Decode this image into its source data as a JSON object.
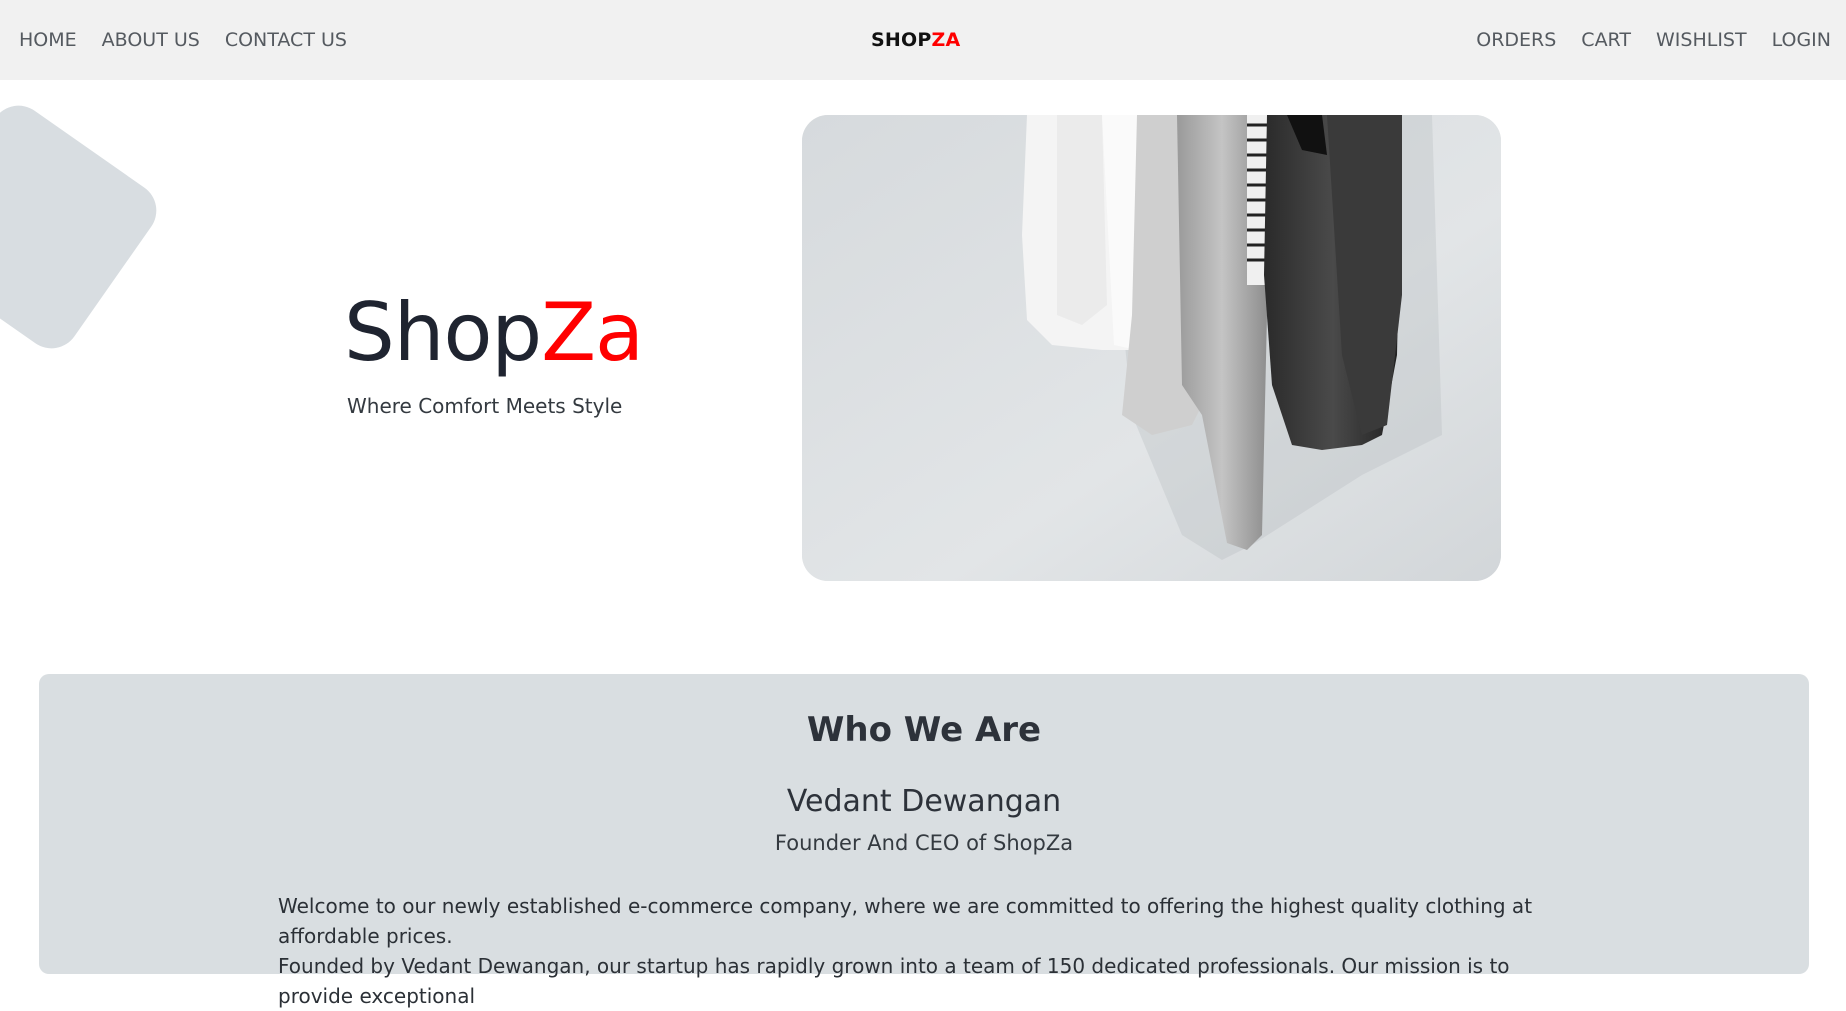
{
  "nav": {
    "left": [
      {
        "label": "HOME"
      },
      {
        "label": "ABOUT US"
      },
      {
        "label": "CONTACT US"
      }
    ],
    "brand_part1": "SHOP",
    "brand_part2": "ZA",
    "right": [
      {
        "label": "ORDERS"
      },
      {
        "label": "CART"
      },
      {
        "label": "WISHLIST"
      },
      {
        "label": "LOGIN"
      }
    ]
  },
  "hero": {
    "title_part1": "Shop",
    "title_part2": "Za",
    "tagline": "Where Comfort Meets Style",
    "image_icon": "hanging-clothes-photo"
  },
  "about": {
    "heading": "Who We Are",
    "founder_name": "Vedant Dewangan",
    "founder_title": "Founder And CEO of ShopZa",
    "paragraph_line1": "Welcome to our newly established e-commerce company, where we are committed to offering the highest quality clothing at affordable prices.",
    "paragraph_line2": "Founded by Vedant Dewangan, our startup has rapidly grown into a team of 150 dedicated professionals. Our mission is to provide exceptional"
  },
  "colors": {
    "accent": "#ff0000",
    "navbar_bg": "#f1f1f1",
    "card_bg": "#d9dee1"
  }
}
